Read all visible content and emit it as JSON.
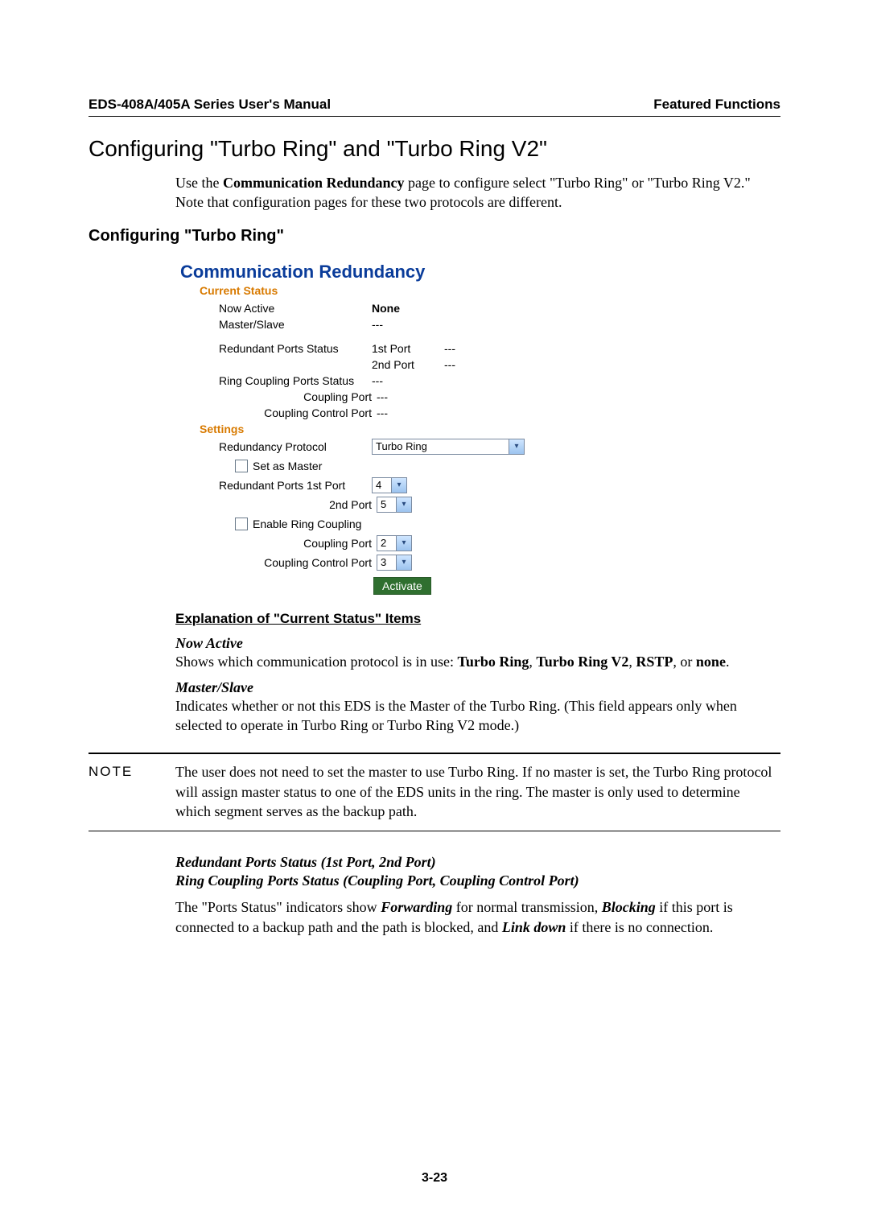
{
  "header": {
    "left": "EDS-408A/405A Series User's Manual",
    "right": "Featured Functions"
  },
  "title": "Configuring \"Turbo Ring\" and \"Turbo Ring V2\"",
  "intro": "Use the Communication Redundancy page to configure select \"Turbo Ring\" or \"Turbo Ring V2.\" Note that configuration pages for these two protocols are different.",
  "subheading": "Configuring \"Turbo Ring\"",
  "ui": {
    "title": "Communication Redundancy",
    "current_status_title": "Current Status",
    "now_active_label": "Now Active",
    "now_active_value": "None",
    "master_slave_label": "Master/Slave",
    "master_slave_value": "---",
    "redundant_ports_status_label": "Redundant Ports Status",
    "port1_label": "1st Port",
    "port1_value": "---",
    "port2_label": "2nd Port",
    "port2_value": "---",
    "ring_coupling_ports_status_label": "Ring Coupling Ports Status",
    "ring_coupling_ports_status_value": "---",
    "coupling_port_label": "Coupling Port",
    "coupling_port_value": "---",
    "coupling_control_port_label": "Coupling Control Port",
    "coupling_control_port_value": "---",
    "settings_title": "Settings",
    "redundancy_protocol_label": "Redundancy Protocol",
    "redundancy_protocol_value": "Turbo Ring",
    "set_as_master_label": "Set as Master",
    "redundant_ports_1st_label": "Redundant Ports 1st Port",
    "redundant_ports_1st_value": "4",
    "redundant_ports_2nd_label": "2nd Port",
    "redundant_ports_2nd_value": "5",
    "enable_ring_coupling_label": "Enable Ring Coupling",
    "coupling_port_set_label": "Coupling Port",
    "coupling_port_set_value": "2",
    "coupling_control_port_set_label": "Coupling Control Port",
    "coupling_control_port_set_value": "3",
    "activate_label": "Activate"
  },
  "explain_heading": "Explanation of \"Current Status\" Items",
  "now_active_heading": "Now Active",
  "now_active_text_1": "Shows which communication protocol is in use: ",
  "now_active_b1": "Turbo Ring",
  "now_active_s1": ", ",
  "now_active_b2": "Turbo Ring V2",
  "now_active_s2": ", ",
  "now_active_b3": "RSTP",
  "now_active_s3": ", or ",
  "now_active_b4": "none",
  "now_active_s4": ".",
  "master_slave_heading": "Master/Slave",
  "master_slave_text": "Indicates whether or not this EDS is the Master of the Turbo Ring. (This field appears only when selected to operate in Turbo Ring or Turbo Ring V2 mode.)",
  "note_label": "NOTE",
  "note_text": "The user does not need to set the master to use Turbo Ring. If no master is set, the Turbo Ring protocol will assign master status to one of the EDS units in the ring. The master is only used to determine which segment serves as the backup path.",
  "rps_heading": "Redundant Ports Status (1st Port, 2nd Port)",
  "rcps_heading": "Ring Coupling Ports Status (Coupling Port, Coupling Control Port)",
  "ports_status_1": "The \"Ports Status\" indicators show ",
  "ports_status_b1": "Forwarding",
  "ports_status_2": " for normal transmission, ",
  "ports_status_b2": "Blocking",
  "ports_status_3": " if this port is connected to a backup path and the path is blocked, and ",
  "ports_status_b3": "Link down",
  "ports_status_4": " if there is no connection.",
  "page_number": "3-23"
}
